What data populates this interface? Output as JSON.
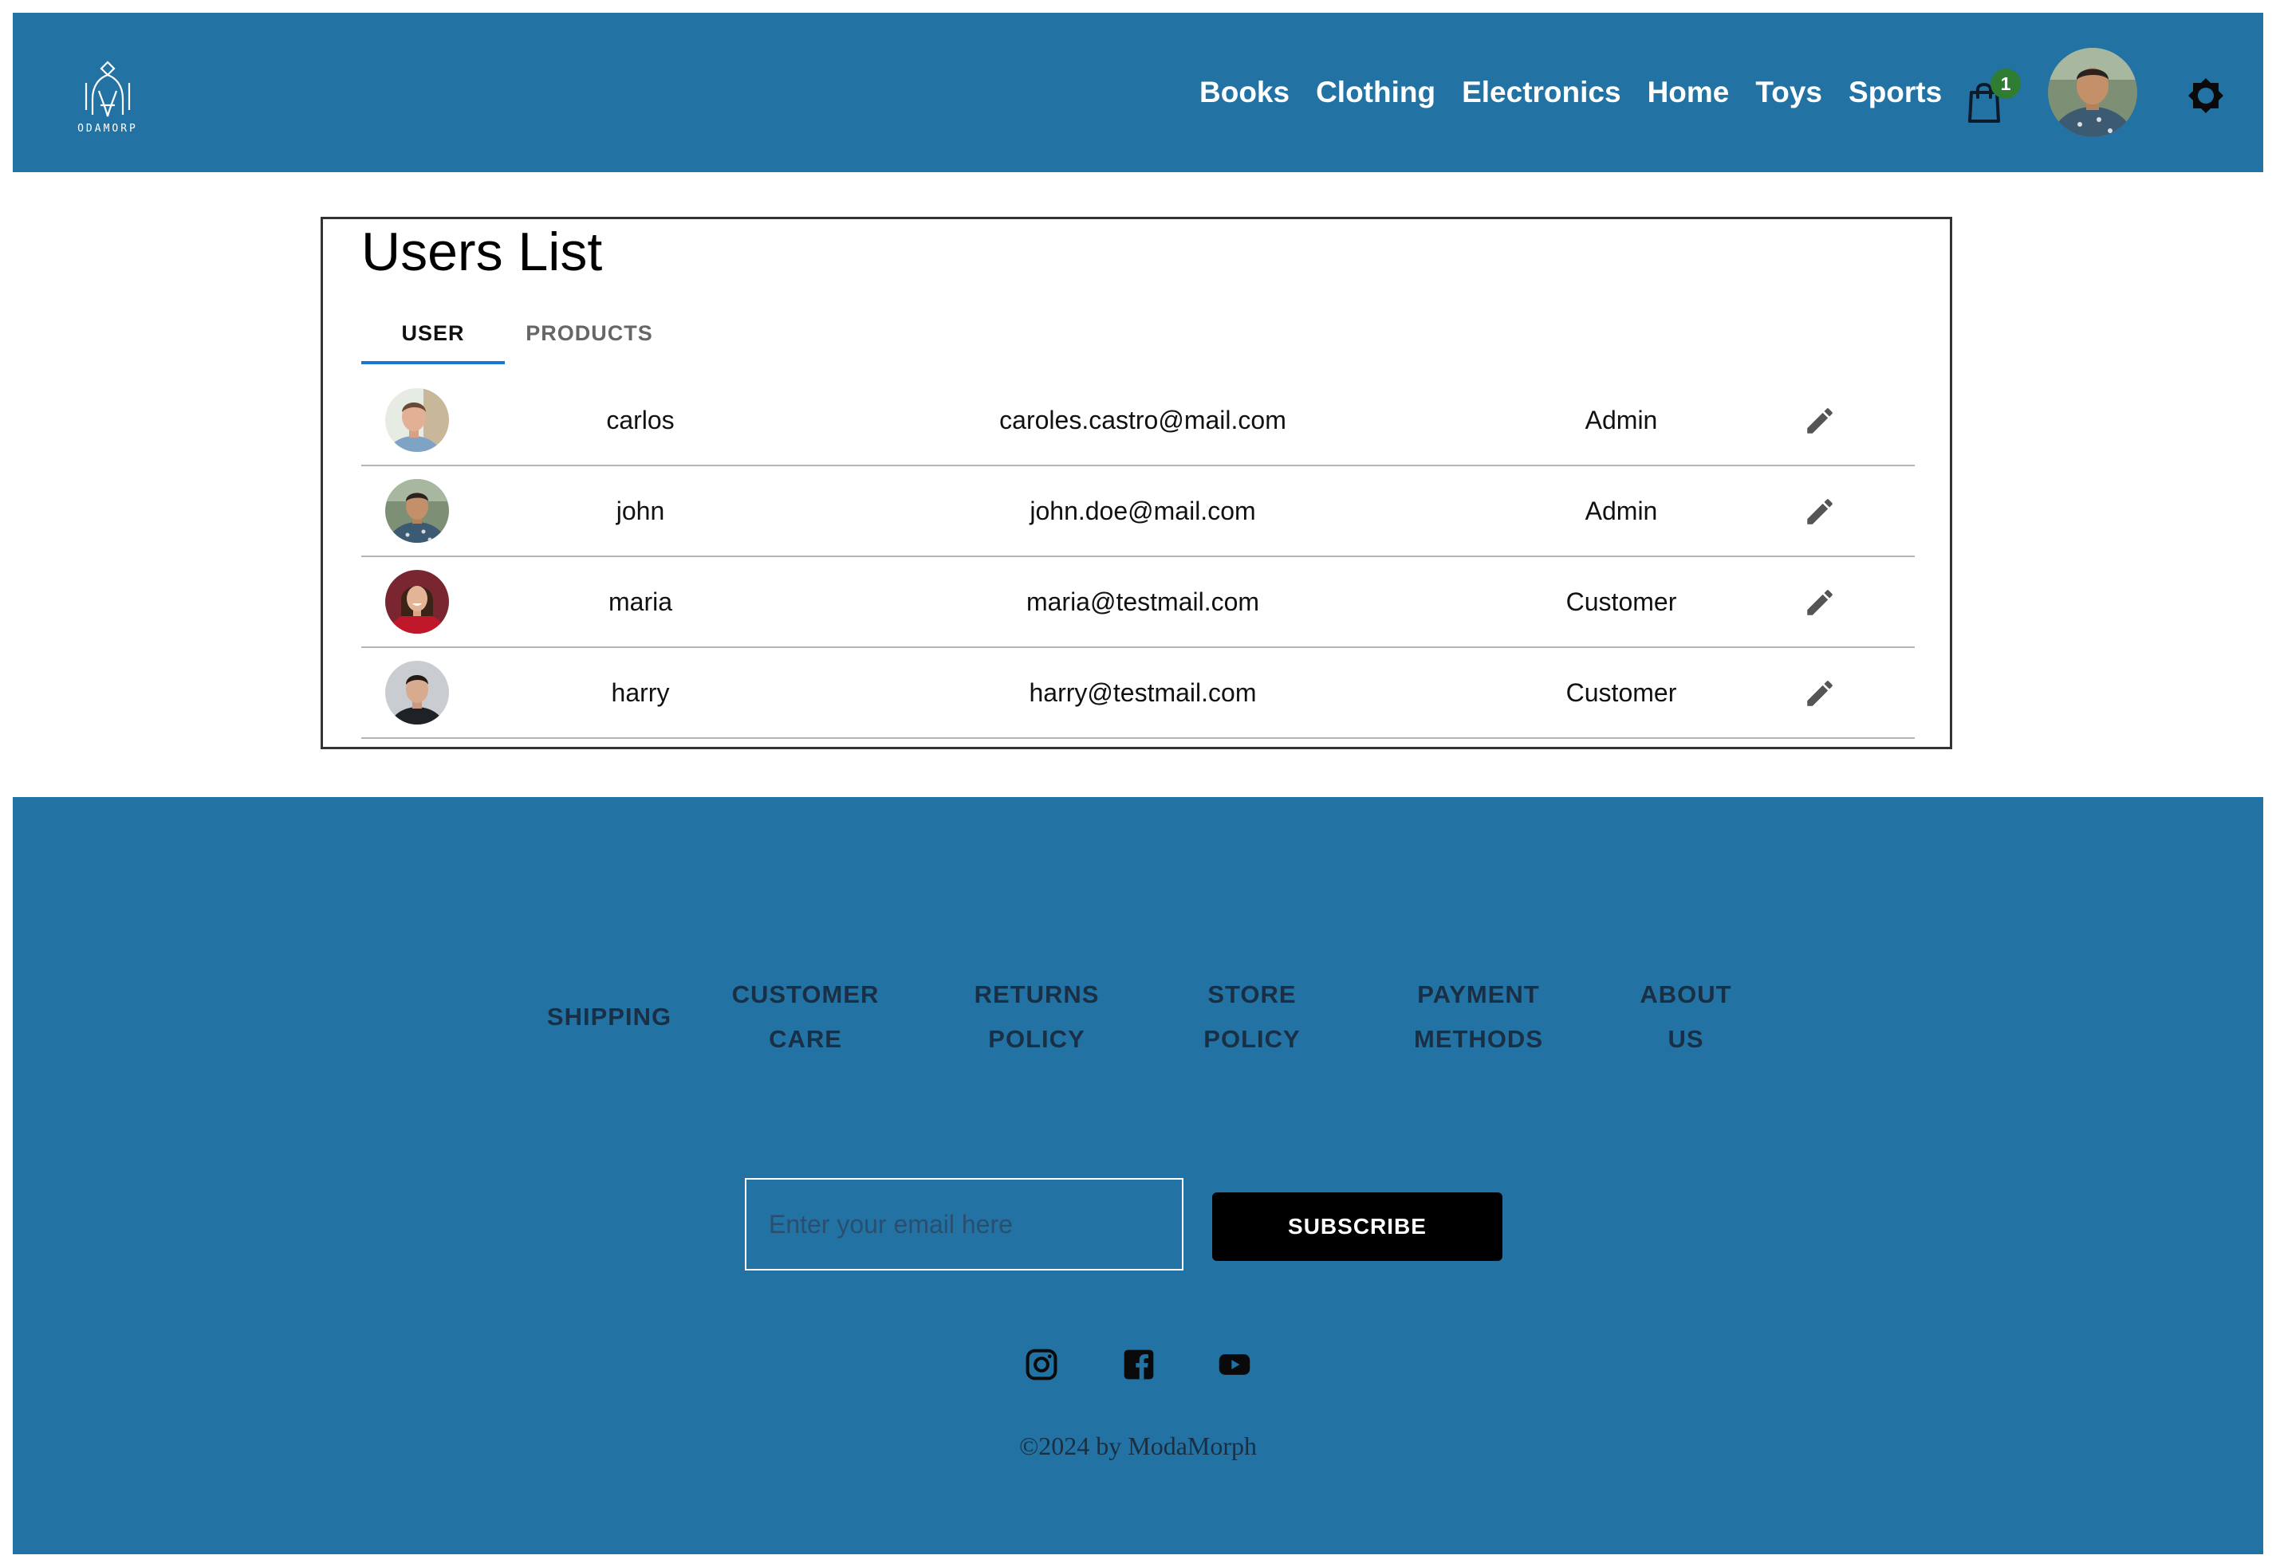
{
  "brand": {
    "logo_text": "ODAMORP"
  },
  "nav": {
    "items": [
      {
        "label": "Books"
      },
      {
        "label": "Clothing"
      },
      {
        "label": "Electronics"
      },
      {
        "label": "Home"
      },
      {
        "label": "Toys"
      },
      {
        "label": "Sports"
      }
    ],
    "cart_count": "1"
  },
  "main": {
    "title": "Users List",
    "tabs": [
      {
        "label": "USER",
        "active": true
      },
      {
        "label": "PRODUCTS",
        "active": false
      }
    ],
    "users": [
      {
        "name": "carlos",
        "email": "caroles.castro@mail.com",
        "role": "Admin"
      },
      {
        "name": "john",
        "email": "john.doe@mail.com",
        "role": "Admin"
      },
      {
        "name": "maria",
        "email": "maria@testmail.com",
        "role": "Customer"
      },
      {
        "name": "harry",
        "email": "harry@testmail.com",
        "role": "Customer"
      }
    ]
  },
  "footer": {
    "links": {
      "shipping": "SHIPPING",
      "customer_care_1": "CUSTOMER",
      "customer_care_2": "CARE",
      "returns_1": "RETURNS",
      "returns_2": "POLICY",
      "store_1": "STORE",
      "store_2": "POLICY",
      "payment_1": "PAYMENT",
      "payment_2": "METHODS",
      "about_1": "ABOUT",
      "about_2": "US"
    },
    "newsletter": {
      "placeholder": "Enter your email here",
      "button_label": "SUBSCRIBE"
    },
    "social_icons": [
      "instagram-icon",
      "facebook-icon",
      "youtube-icon"
    ],
    "copyright": "©2024 by ModaMorph"
  },
  "colors": {
    "primary": "#2273a3",
    "tab_indicator": "#1976d2",
    "badge": "#2e7d32",
    "button": "#000000"
  }
}
